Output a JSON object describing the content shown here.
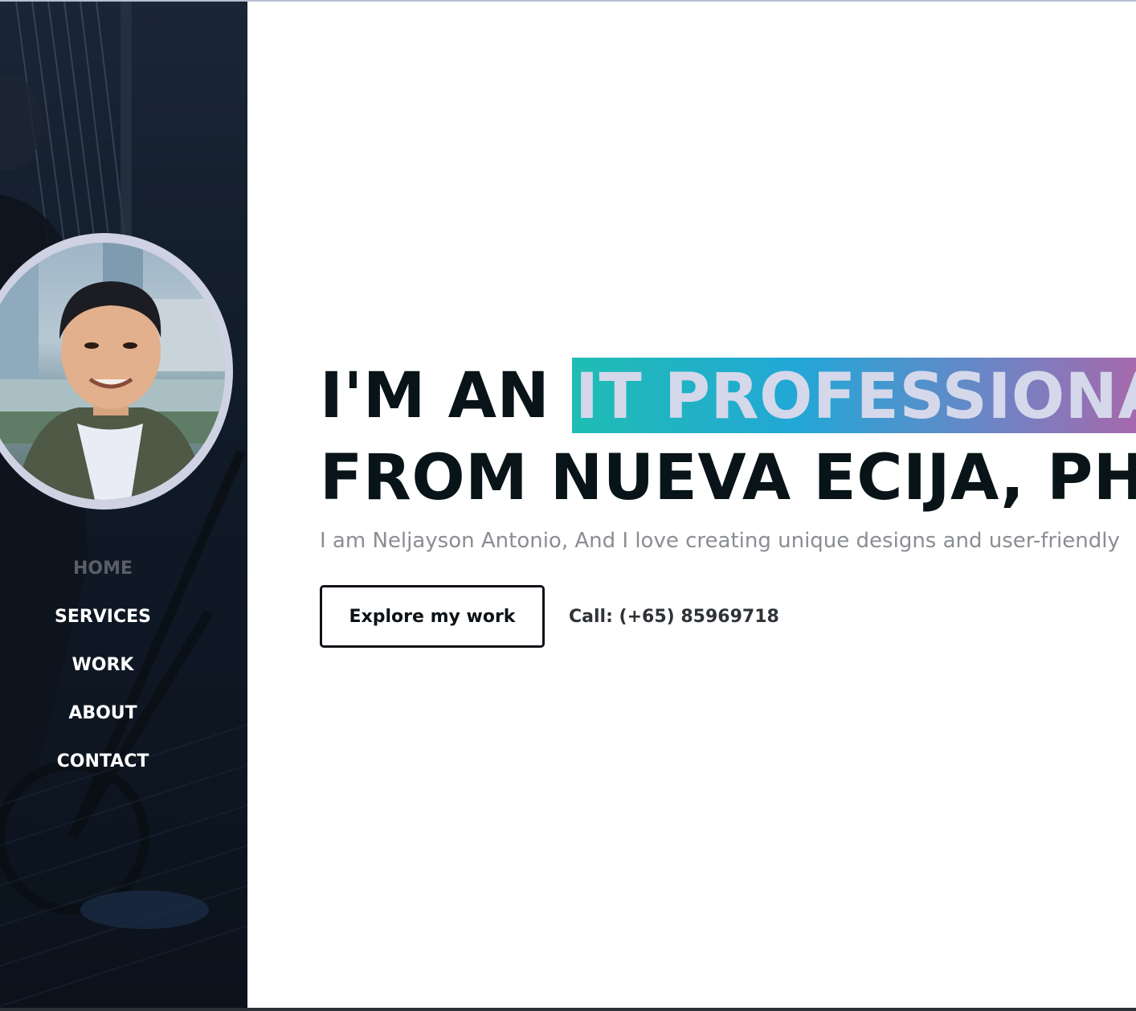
{
  "sidebar": {
    "photo": {
      "type": "photo"
    },
    "nav": [
      {
        "label": "HOME",
        "active": true
      },
      {
        "label": "SERVICES",
        "active": false
      },
      {
        "label": "WORK",
        "active": false
      },
      {
        "label": "ABOUT",
        "active": false
      },
      {
        "label": "CONTACT",
        "active": false
      }
    ]
  },
  "hero": {
    "headline_prefix": "I'M AN ",
    "headline_highlight": "IT PROFESSIONAL",
    "headline_line2": "FROM NUEVA ECIJA, PH",
    "intro": "I am Neljayson Antonio, And I love creating unique designs and user-friendly",
    "cta_label": "Explore my work",
    "call_text": "Call: (+65) 85969718"
  },
  "colors": {
    "sidebar_bg": "#111b28",
    "highlight_gradient": [
      "#1fbdb3",
      "#22a7d6",
      "#6b86c6",
      "#c45aa0"
    ],
    "headline": "#081418",
    "intro_text": "#8a8d92",
    "nav_active": "#5a5f67"
  }
}
